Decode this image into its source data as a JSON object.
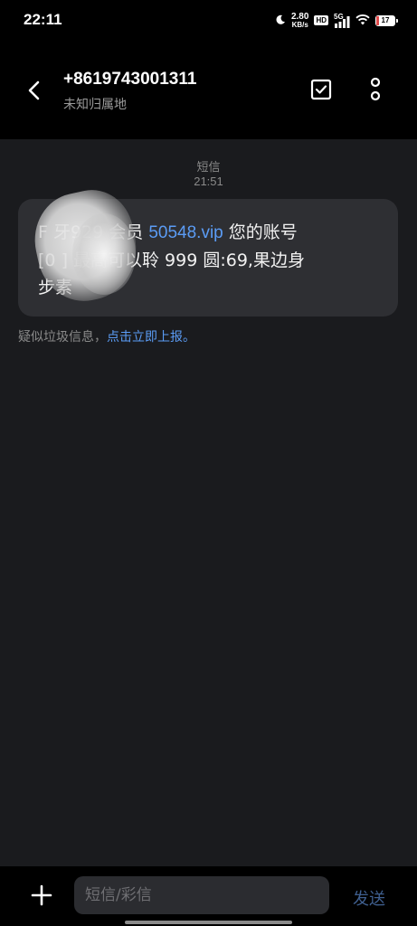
{
  "status_bar": {
    "time": "22:11",
    "speed_value": "2.80",
    "speed_unit": "KB/s",
    "hd_label": "HD",
    "network_label": "5G",
    "battery_level": "17",
    "battery_fraction": 0.17,
    "battery_fill_color": "#e04a4a",
    "icons": [
      "moon-icon",
      "hd-icon",
      "signal-5g-icon",
      "wifi-icon",
      "battery-icon"
    ]
  },
  "header": {
    "contact_number": "+8619743001311",
    "location": "未知归属地",
    "icons": [
      "back-arrow-icon",
      "checkbox-icon",
      "more-vertical-icon"
    ]
  },
  "conversation": {
    "message_type": "短信",
    "time": "21:51",
    "message": {
      "line1_prefix": "F",
      "line1_mid": "牙929 会员 ",
      "link": "50548.vip",
      "line1_suffix": " 您的账号",
      "line2_prefix": "[0",
      "line2_mid": "] 最高可以聆 999 圆:69,果边身",
      "line3": "步素"
    },
    "spam_hint": "疑似垃圾信息，",
    "spam_report_link": "点击立即上报。"
  },
  "composer": {
    "placeholder": "短信/彩信",
    "send_label": "发送",
    "icons": [
      "plus-icon"
    ]
  },
  "colors": {
    "background": "#1a1b1e",
    "bubble": "#2e2f33",
    "link": "#5b9cf5",
    "send_disabled": "#3f5f8f"
  }
}
